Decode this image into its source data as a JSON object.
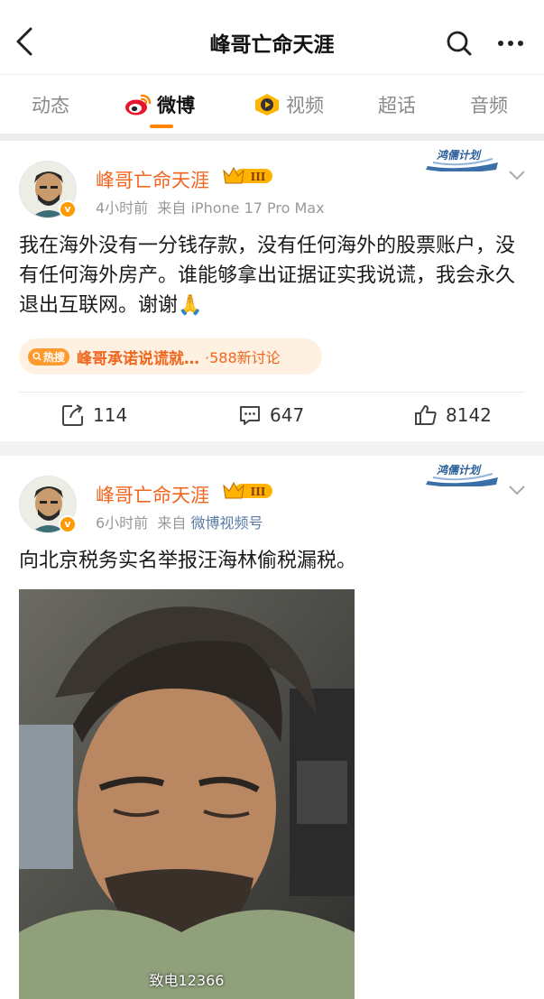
{
  "header": {
    "title": "峰哥亡命天涯",
    "back_icon": "chevron-left-icon",
    "search_icon": "search-icon",
    "more_icon": "more-dots-icon"
  },
  "tabs": [
    {
      "label": "动态",
      "active": false
    },
    {
      "label": "微博",
      "active": true,
      "icon": "weibo-logo-icon"
    },
    {
      "label": "视频",
      "active": false,
      "icon": "video-play-icon"
    },
    {
      "label": "超话",
      "active": false
    },
    {
      "label": "音频",
      "active": false
    }
  ],
  "accent_color": "#ff8200",
  "posts": [
    {
      "author": "峰哥亡命天涯",
      "time": "4小时前",
      "source_prefix": "来自",
      "source": "iPhone 17 Pro Max",
      "badge": "鸿儒计划",
      "vip_level": "III",
      "text": "我在海外没有一分钱存款，没有任何海外的股票账户，没有任何海外房产。谁能够拿出证据证实我说谎，我会永久退出互联网。谢谢🙏",
      "hot_tag": "热搜",
      "hot_topic": "峰哥承诺说谎就…",
      "hot_count": "·588新讨论",
      "reposts": "114",
      "comments": "647",
      "likes": "8142"
    },
    {
      "author": "峰哥亡命天涯",
      "time": "6小时前",
      "source_prefix": "来自",
      "source": "微博视频号",
      "badge": "鸿儒计划",
      "vip_level": "III",
      "text": "向北京税务实名举报汪海林偷税漏税。",
      "video_caption": "致电12366"
    }
  ]
}
